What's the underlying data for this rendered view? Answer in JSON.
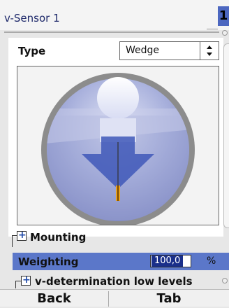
{
  "header": {
    "title": "v-Sensor 1",
    "page_number": "1"
  },
  "type_field": {
    "label": "Type",
    "selected": "Wedge"
  },
  "sensor_view": {
    "icon": "wedge-sensor-illustration"
  },
  "sections": {
    "mounting": "Mounting",
    "v_determination": "v-determination low levels"
  },
  "weighting": {
    "label": "Weighting",
    "value": "100,0",
    "unit": "%"
  },
  "softkeys": {
    "back": "Back",
    "tab": "Tab"
  },
  "colors": {
    "accent": "#5b77c9",
    "highlight": "#1a2f8a"
  }
}
